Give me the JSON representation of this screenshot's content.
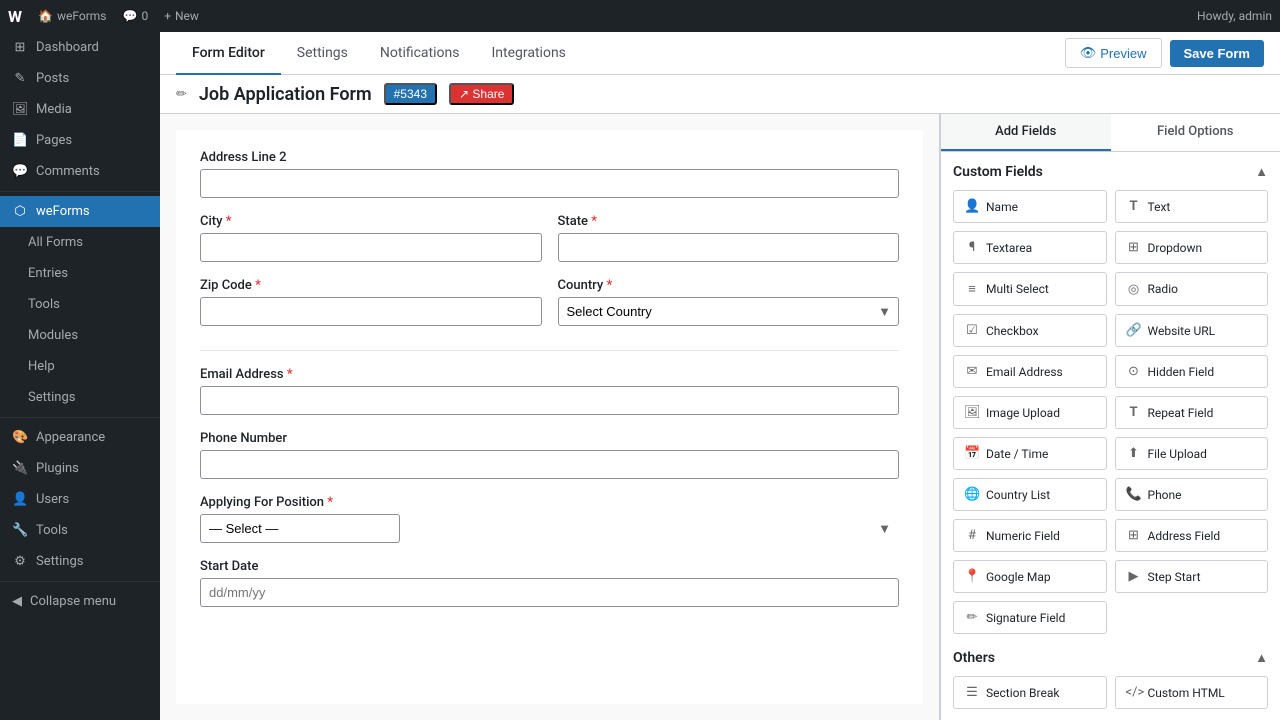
{
  "adminbar": {
    "logo_text": "W",
    "site_name": "weForms",
    "comments_count": "0",
    "new_label": "New",
    "howdy": "Howdy, admin"
  },
  "sidebar": {
    "items": [
      {
        "id": "dashboard",
        "label": "Dashboard",
        "icon": "⊞"
      },
      {
        "id": "posts",
        "label": "Posts",
        "icon": "✎"
      },
      {
        "id": "media",
        "label": "Media",
        "icon": "⬜"
      },
      {
        "id": "pages",
        "label": "Pages",
        "icon": "📄"
      },
      {
        "id": "comments",
        "label": "Comments",
        "icon": "💬"
      },
      {
        "id": "weforms",
        "label": "weForms",
        "icon": "⬡",
        "active": true
      },
      {
        "id": "all-forms",
        "label": "All Forms",
        "icon": ""
      },
      {
        "id": "entries",
        "label": "Entries",
        "icon": ""
      },
      {
        "id": "tools",
        "label": "Tools",
        "icon": ""
      },
      {
        "id": "modules",
        "label": "Modules",
        "icon": ""
      },
      {
        "id": "help",
        "label": "Help",
        "icon": ""
      },
      {
        "id": "settings-sub",
        "label": "Settings",
        "icon": ""
      },
      {
        "id": "appearance",
        "label": "Appearance",
        "icon": "🎨"
      },
      {
        "id": "plugins",
        "label": "Plugins",
        "icon": "🔌"
      },
      {
        "id": "users",
        "label": "Users",
        "icon": "👤"
      },
      {
        "id": "tools-main",
        "label": "Tools",
        "icon": "🔧"
      },
      {
        "id": "settings",
        "label": "Settings",
        "icon": "⚙"
      }
    ],
    "collapse_label": "Collapse menu"
  },
  "tabs": [
    {
      "id": "form-editor",
      "label": "Form Editor",
      "active": true
    },
    {
      "id": "settings",
      "label": "Settings"
    },
    {
      "id": "notifications",
      "label": "Notifications"
    },
    {
      "id": "integrations",
      "label": "Integrations"
    }
  ],
  "form": {
    "title": "Job Application Form",
    "badge_id": "#5343",
    "share_label": "Share",
    "fields": {
      "address_line2_label": "Address Line 2",
      "city_label": "City",
      "city_required": "*",
      "state_label": "State",
      "state_required": "*",
      "country_label": "Country",
      "country_required": "*",
      "select_country_placeholder": "Select Country",
      "zip_label": "Zip Code",
      "zip_required": "*",
      "email_label": "Email Address",
      "email_required": "*",
      "phone_label": "Phone Number",
      "position_label": "Applying For Position",
      "position_required": "*",
      "position_default": "— Select —",
      "start_date_label": "Start Date",
      "start_date_placeholder": "dd/mm/yy"
    }
  },
  "actions": {
    "preview_label": "Preview",
    "save_label": "Save Form"
  },
  "fields_panel": {
    "tab_add": "Add Fields",
    "tab_options": "Field Options",
    "custom_fields_title": "Custom Fields",
    "others_title": "Others",
    "custom_fields": [
      {
        "id": "name",
        "label": "Name",
        "icon": "👤"
      },
      {
        "id": "text",
        "label": "Text",
        "icon": "T"
      },
      {
        "id": "textarea",
        "label": "Textarea",
        "icon": "¶"
      },
      {
        "id": "dropdown",
        "label": "Dropdown",
        "icon": "⊞"
      },
      {
        "id": "multi-select",
        "label": "Multi Select",
        "icon": "≡"
      },
      {
        "id": "radio",
        "label": "Radio",
        "icon": "◎"
      },
      {
        "id": "checkbox",
        "label": "Checkbox",
        "icon": "☑"
      },
      {
        "id": "website-url",
        "label": "Website URL",
        "icon": "🔗"
      },
      {
        "id": "email-address",
        "label": "Email Address",
        "icon": "✉"
      },
      {
        "id": "hidden-field",
        "label": "Hidden Field",
        "icon": "⊙"
      },
      {
        "id": "image-upload",
        "label": "Image Upload",
        "icon": "🖼"
      },
      {
        "id": "repeat-field",
        "label": "Repeat Field",
        "icon": "T"
      },
      {
        "id": "date-time",
        "label": "Date / Time",
        "icon": "📅"
      },
      {
        "id": "file-upload",
        "label": "File Upload",
        "icon": "⬆"
      },
      {
        "id": "country-list",
        "label": "Country List",
        "icon": "🌐"
      },
      {
        "id": "phone",
        "label": "Phone",
        "icon": "📞"
      },
      {
        "id": "numeric-field",
        "label": "Numeric Field",
        "icon": "#"
      },
      {
        "id": "address-field",
        "label": "Address Field",
        "icon": "⊞"
      },
      {
        "id": "google-map",
        "label": "Google Map",
        "icon": "📍"
      },
      {
        "id": "step-start",
        "label": "Step Start",
        "icon": "▶"
      },
      {
        "id": "signature-field",
        "label": "Signature Field",
        "icon": "✏"
      }
    ],
    "others_fields": [
      {
        "id": "section-break",
        "label": "Section Break",
        "icon": "☰"
      },
      {
        "id": "custom-html",
        "label": "Custom HTML",
        "icon": "</>"
      }
    ]
  }
}
